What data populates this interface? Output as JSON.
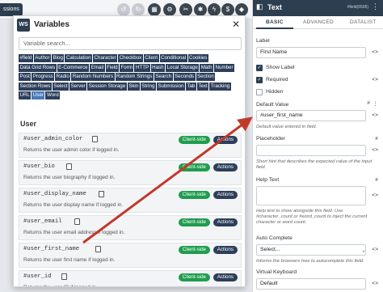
{
  "toolbar": {
    "left_tab": "ssions"
  },
  "modal": {
    "logo": "WS",
    "title": "Variables",
    "search_placeholder": "Variable search...",
    "tags": [
      "#field",
      "Author",
      "Blog",
      "Calculation",
      "Character",
      "Checkbox",
      "Client",
      "Conditional",
      "Cookies",
      "Data Grid Rows",
      "E-Commerce",
      "Email",
      "Field",
      "Form",
      "HTTP",
      "Hash",
      "Local Storage",
      "Math",
      "Number",
      "Post",
      "Progress",
      "Radio",
      "Random Numbers",
      "Random Strings",
      "Search",
      "Seconds",
      "Section",
      "Section Rows",
      "Select",
      "Server",
      "Session Storage",
      "Skin",
      "String",
      "Submission",
      "Tab",
      "Text",
      "Tracking",
      "URL",
      "User",
      "Word"
    ],
    "active_tag": "User",
    "section": "User",
    "variables": [
      {
        "name": "#user_admin_color",
        "desc": "Returns the user admin color if logged in.",
        "badge": "Client-side",
        "action": "Actions"
      },
      {
        "name": "#user_bio",
        "desc": "Returns the user biography if logged in.",
        "badge": "Client-side",
        "action": "Actions"
      },
      {
        "name": "#user_display_name",
        "desc": "Returns the user display name if logged in.",
        "badge": "Client-side",
        "action": "Actions"
      },
      {
        "name": "#user_email",
        "desc": "Returns the user email address if logged in.",
        "badge": "Client-side",
        "action": "Actions"
      },
      {
        "name": "#user_first_name",
        "desc": "Returns the user first name if logged in.",
        "badge": "Client-side",
        "action": "Actions"
      },
      {
        "name": "#user_id",
        "desc": "Returns the user ID if logged in.",
        "badge": "Client-side",
        "action": "Actions"
      }
    ]
  },
  "panel": {
    "title": "Text",
    "field_id": "#field(6506)",
    "tabs": [
      "BASIC",
      "ADVANCED",
      "DATALIST"
    ],
    "label_label": "Label",
    "label_value": "First Name",
    "show_label": "Show Label",
    "required": "Required",
    "hidden": "Hidden",
    "default_value_label": "Default Value",
    "default_value": "#user_first_name",
    "default_value_help": "Default value entered in field.",
    "placeholder_label": "Placeholder",
    "placeholder_help": "Short hint that describes the expected value of the input field.",
    "help_text_label": "Help Text",
    "help_text_help": "Help text to show alongside this field. Use #character_count or #word_count to inject the current character or word count.",
    "autocomplete_label": "Auto Complete",
    "autocomplete_value": "Select...",
    "autocomplete_help": "Informs the browsers how to autocomplete this field.",
    "keyboard_label": "Virtual Keyboard",
    "keyboard_value": "Default",
    "variable_icon": "<>",
    "calc_icon": "#"
  },
  "colors": {
    "panel_header": "#2d3e50",
    "tag_bg": "#2c3e5a",
    "client_side_badge": "#1f9d4e",
    "arrow": "#c0392b"
  }
}
